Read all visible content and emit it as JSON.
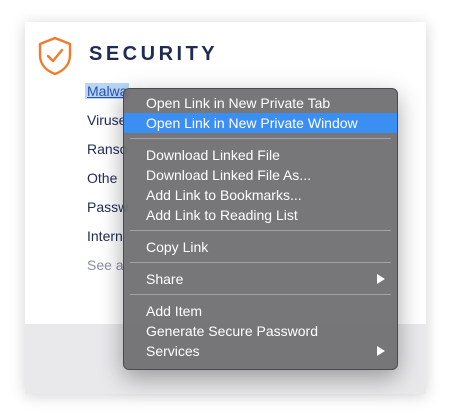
{
  "card": {
    "icon": "shield-check-icon",
    "title": "SECURITY",
    "links": [
      {
        "label": "Malwa",
        "selected": true
      },
      {
        "label": "Viruse"
      },
      {
        "label": "Ranso"
      },
      {
        "label": "Othe"
      },
      {
        "label": "Passw"
      },
      {
        "label": "Intern"
      },
      {
        "label": "See a",
        "muted": true
      }
    ]
  },
  "context_menu": {
    "groups": [
      [
        {
          "label": "Open Link in New Private Tab"
        },
        {
          "label": "Open Link in New Private Window",
          "highlighted": true
        }
      ],
      [
        {
          "label": "Download Linked File"
        },
        {
          "label": "Download Linked File As..."
        },
        {
          "label": "Add Link to Bookmarks..."
        },
        {
          "label": "Add Link to Reading List"
        }
      ],
      [
        {
          "label": "Copy Link"
        }
      ],
      [
        {
          "label": "Share",
          "submenu": true
        }
      ],
      [
        {
          "label": "Add Item"
        },
        {
          "label": "Generate Secure Password"
        },
        {
          "label": "Services",
          "submenu": true
        }
      ]
    ],
    "submenu_icon": "chevron-right-icon"
  },
  "colors": {
    "accent_orange": "#f07b2a",
    "title_navy": "#1f2a55",
    "menu_highlight": "#3b8ff3"
  }
}
